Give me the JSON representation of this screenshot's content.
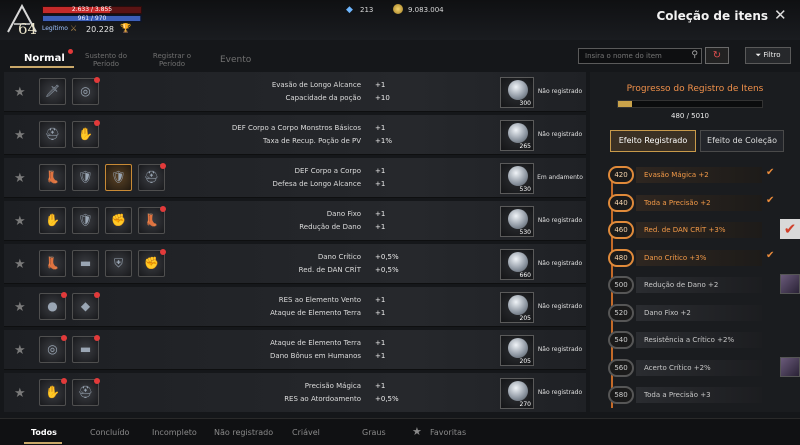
{
  "hud": {
    "level": "64",
    "hp_text": "2.633 / 3.855",
    "hp_fraction": 0.68,
    "mp_text": "961 / 970",
    "mp_fraction": 0.99,
    "legit_label": "Legítimo",
    "rank_value": "20.228",
    "gems": "213",
    "gold": "9.083.004",
    "colors": {
      "hp": "#c42a2a",
      "mp": "#3d5fb8",
      "accent": "#f0904a"
    }
  },
  "page_title": "Coleção de itens",
  "tabs": [
    {
      "label": "Normal"
    },
    {
      "label": "Sustento do Período"
    },
    {
      "label": "Registrar o Período"
    },
    {
      "label": "Evento"
    }
  ],
  "search": {
    "placeholder": "Insira o nome do item"
  },
  "filter_label": "Filtro",
  "rows": [
    {
      "stats": [
        {
          "name": "Evasão de Longo Alcance",
          "value": "+1"
        },
        {
          "name": "Capacidade da poção",
          "value": "+10"
        }
      ],
      "count": "300",
      "status": "Não registrado",
      "icons": [
        "dagger-icon",
        "ring-icon"
      ]
    },
    {
      "stats": [
        {
          "name": "DEF Corpo a Corpo Monstros Básicos",
          "value": "+1"
        },
        {
          "name": "Taxa de Recup. Poção de PV",
          "value": "+1%"
        }
      ],
      "count": "265",
      "status": "Não registrado",
      "icons": [
        "helmet-icon",
        "gauntlet-icon"
      ]
    },
    {
      "stats": [
        {
          "name": "DEF Corpo a Corpo",
          "value": "+1"
        },
        {
          "name": "Defesa de Longo Alcance",
          "value": "+1"
        }
      ],
      "count": "530",
      "status": "Em andamento",
      "icons": [
        "boots-icon",
        "armor-icon",
        "armor-icon",
        "helmet-icon"
      ]
    },
    {
      "stats": [
        {
          "name": "Dano Fixo",
          "value": "+1"
        },
        {
          "name": "Redução de Dano",
          "value": "+1"
        }
      ],
      "count": "530",
      "status": "Não registrado",
      "icons": [
        "gauntlet-icon",
        "armor-icon",
        "glove-icon",
        "boots-icon"
      ]
    },
    {
      "stats": [
        {
          "name": "Dano Crítico",
          "value": "+0,5%"
        },
        {
          "name": "Red. de DAN CRÍT",
          "value": "+0,5%"
        }
      ],
      "count": "660",
      "status": "Não registrado",
      "icons": [
        "boots-icon",
        "belt-icon",
        "shield-icon",
        "glove-icon"
      ]
    },
    {
      "stats": [
        {
          "name": "RES ao Elemento Vento",
          "value": "+1"
        },
        {
          "name": "Ataque de Elemento Terra",
          "value": "+1"
        }
      ],
      "count": "205",
      "status": "Não registrado",
      "icons": [
        "orb-icon",
        "gem-icon"
      ]
    },
    {
      "stats": [
        {
          "name": "Ataque de Elemento Terra",
          "value": "+1"
        },
        {
          "name": "Dano Bônus em Humanos",
          "value": "+1"
        }
      ],
      "count": "205",
      "status": "Não registrado",
      "icons": [
        "ring-icon",
        "belt-icon"
      ]
    },
    {
      "stats": [
        {
          "name": "Precisão Mágica",
          "value": "+1"
        },
        {
          "name": "RES ao Atordoamento",
          "value": "+0,5%"
        }
      ],
      "count": "270",
      "status": "Não registrado",
      "icons": [
        "gauntlet-icon",
        "helmet-icon"
      ]
    }
  ],
  "panel": {
    "title": "Progresso do Registro de Itens",
    "progress_text": "480 / 5010",
    "progress_fraction": 0.096,
    "btn_registered": "Efeito Registrado",
    "btn_collection": "Efeito de Coleção",
    "bonuses": [
      {
        "num": "420",
        "label": "Evasão Mágica +2",
        "on": true,
        "mark": "check"
      },
      {
        "num": "440",
        "label": "Toda a Precisão +2",
        "on": true,
        "mark": "check"
      },
      {
        "num": "460",
        "label": "Red. de DAN CRÍT +3%",
        "on": true,
        "mark": "bigcheck"
      },
      {
        "num": "480",
        "label": "Dano Crítico +3%",
        "on": true,
        "mark": "check"
      },
      {
        "num": "500",
        "label": "Redução de Dano +2",
        "on": false,
        "mark": "thumb"
      },
      {
        "num": "520",
        "label": "Dano Fixo +2",
        "on": false,
        "mark": ""
      },
      {
        "num": "540",
        "label": "Resistência a Crítico +2%",
        "on": false,
        "mark": ""
      },
      {
        "num": "560",
        "label": "Acerto Crítico +2%",
        "on": false,
        "mark": "thumb"
      },
      {
        "num": "580",
        "label": "Toda a Precisão +3",
        "on": false,
        "mark": ""
      }
    ]
  },
  "bottom_tabs": [
    {
      "label": "Todos"
    },
    {
      "label": "Concluído"
    },
    {
      "label": "Incompleto"
    },
    {
      "label": "Não registrado"
    },
    {
      "label": "Criável"
    },
    {
      "label": "Graus"
    },
    {
      "label": "Favoritas"
    }
  ]
}
